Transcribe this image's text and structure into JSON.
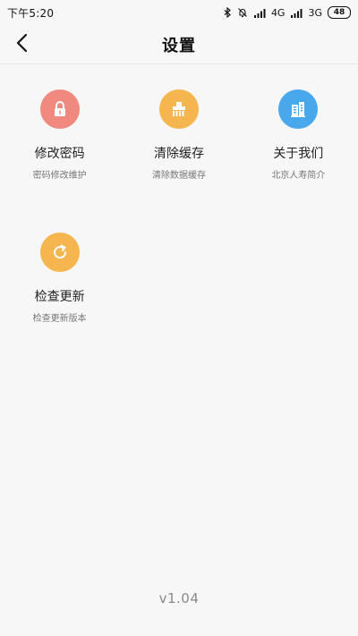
{
  "status_bar": {
    "time": "下午5:20",
    "network_1": "4G",
    "network_2": "3G",
    "battery": "48"
  },
  "header": {
    "title": "设置",
    "back_icon": "chevron-left-icon"
  },
  "tiles": [
    {
      "title": "修改密码",
      "subtitle": "密码修改维护",
      "icon": "lock-icon",
      "color": "#f08a80"
    },
    {
      "title": "清除缓存",
      "subtitle": "清除数据缓存",
      "icon": "brush-icon",
      "color": "#f5b54f"
    },
    {
      "title": "关于我们",
      "subtitle": "北京人寿简介",
      "icon": "building-icon",
      "color": "#49a7ec"
    },
    {
      "title": "检查更新",
      "subtitle": "检查更新版本",
      "icon": "refresh-icon",
      "color": "#f5b54f"
    }
  ],
  "footer": {
    "version": "v1.04"
  }
}
